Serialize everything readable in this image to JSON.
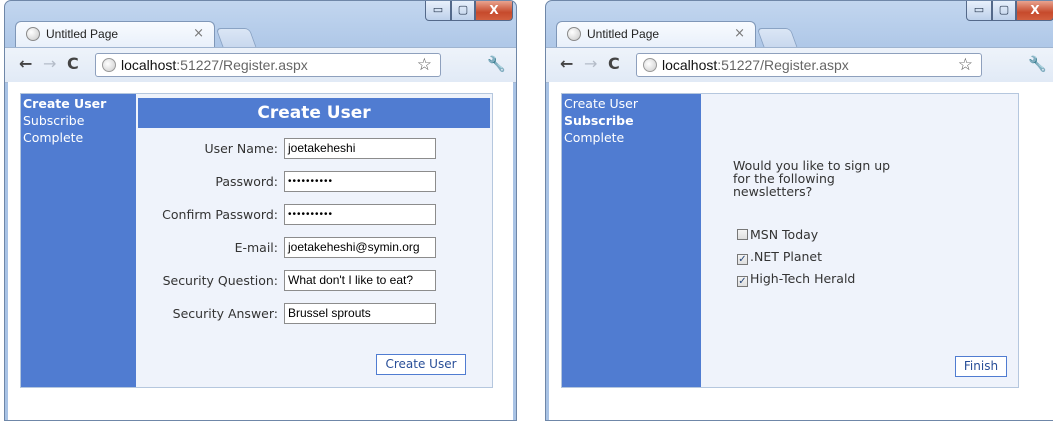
{
  "windows": [
    {
      "tab_title": "Untitled Page",
      "tab_close": "×",
      "url_host": "localhost",
      "url_rest": ":51227/Register.aspx",
      "sidebar": [
        "Create User",
        "Subscribe",
        "Complete"
      ],
      "active_step": "Create User",
      "header": "Create User",
      "fields": [
        {
          "label": "User Name:",
          "value": "joetakeheshi"
        },
        {
          "label": "Password:",
          "value": "••••••••••"
        },
        {
          "label": "Confirm Password:",
          "value": "••••••••••"
        },
        {
          "label": "E-mail:",
          "value": "joetakeheshi@symin.org"
        },
        {
          "label": "Security Question:",
          "value": "What don't I like to eat?"
        },
        {
          "label": "Security Answer:",
          "value": "Brussel sprouts"
        }
      ],
      "button": "Create User"
    },
    {
      "tab_title": "Untitled Page",
      "tab_close": "×",
      "url_host": "localhost",
      "url_rest": ":51227/Register.aspx",
      "sidebar": [
        "Create User",
        "Subscribe",
        "Complete"
      ],
      "active_step": "Subscribe",
      "question_lines": [
        "Would you like to sign up",
        "for the following",
        "newsletters?"
      ],
      "options": [
        {
          "label": "MSN Today",
          "checked": false
        },
        {
          "label": ".NET Planet",
          "checked": true
        },
        {
          "label": "High-Tech Herald",
          "checked": true
        }
      ],
      "button": "Finish"
    }
  ],
  "colors": {
    "sidebar": "#507cd1",
    "page_background": "#eff3fb",
    "button_text": "#284e98",
    "frame": "#a9c3e5"
  },
  "icons": {
    "back": "←",
    "forward": "→",
    "reload": "C",
    "star": "☆",
    "wrench": "🔧",
    "minimize": "▭",
    "maximize": "▢",
    "close": "X",
    "checkmark": "✓"
  }
}
